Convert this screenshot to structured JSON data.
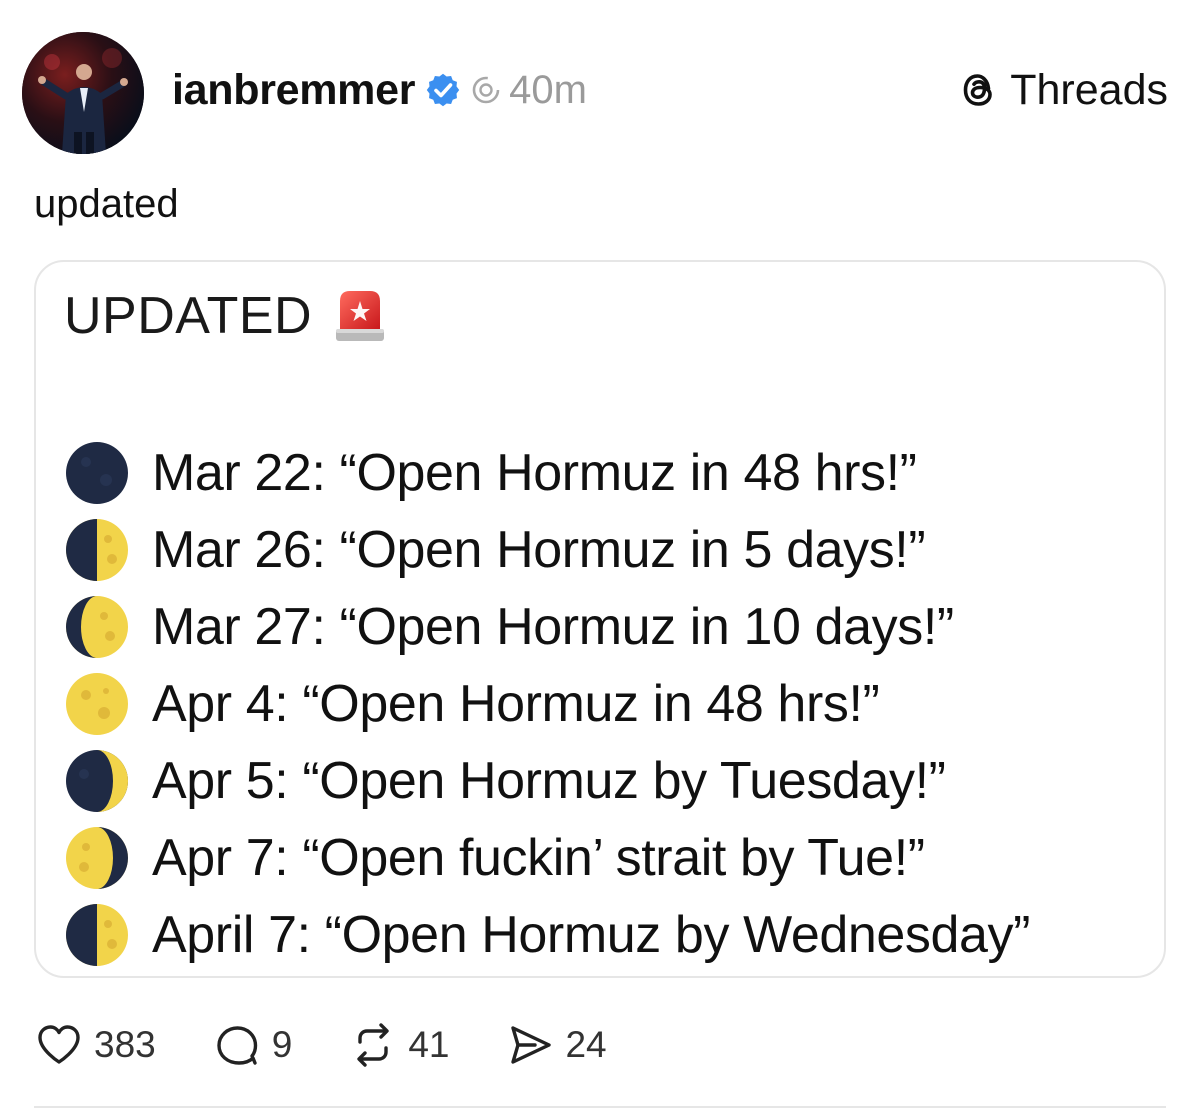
{
  "post": {
    "username": "ianbremmer",
    "timestamp": "40m",
    "text": "updated"
  },
  "brand": {
    "name": "Threads"
  },
  "card": {
    "title": "UPDATED",
    "items": [
      {
        "moon": "new-moon-icon",
        "text": "Mar 22: “Open Hormuz in 48 hrs!”"
      },
      {
        "moon": "first-quarter-moon-icon",
        "text": "Mar 26: “Open Hormuz in 5 days!”"
      },
      {
        "moon": "waxing-gibbous-moon-icon",
        "text": "Mar 27: “Open Hormuz in 10 days!”"
      },
      {
        "moon": "full-moon-icon",
        "text": "Apr 4: “Open Hormuz in 48 hrs!”"
      },
      {
        "moon": "waxing-crescent-moon-icon",
        "text": "Apr 5: “Open Hormuz by Tuesday!”"
      },
      {
        "moon": "waning-gibbous-moon-icon",
        "text": "Apr 7: “Open fuckin’ strait by Tue!”"
      },
      {
        "moon": "first-quarter-moon-icon",
        "text": "April 7: “Open Hormuz by Wednesday”"
      }
    ]
  },
  "actions": {
    "likes": "383",
    "replies": "9",
    "reposts": "41",
    "shares": "24"
  },
  "colors": {
    "verified": "#3b8ff0",
    "moon_dark": "#1f2a44",
    "moon_light": "#f2d44a",
    "siren_red": "#e02a2a"
  }
}
